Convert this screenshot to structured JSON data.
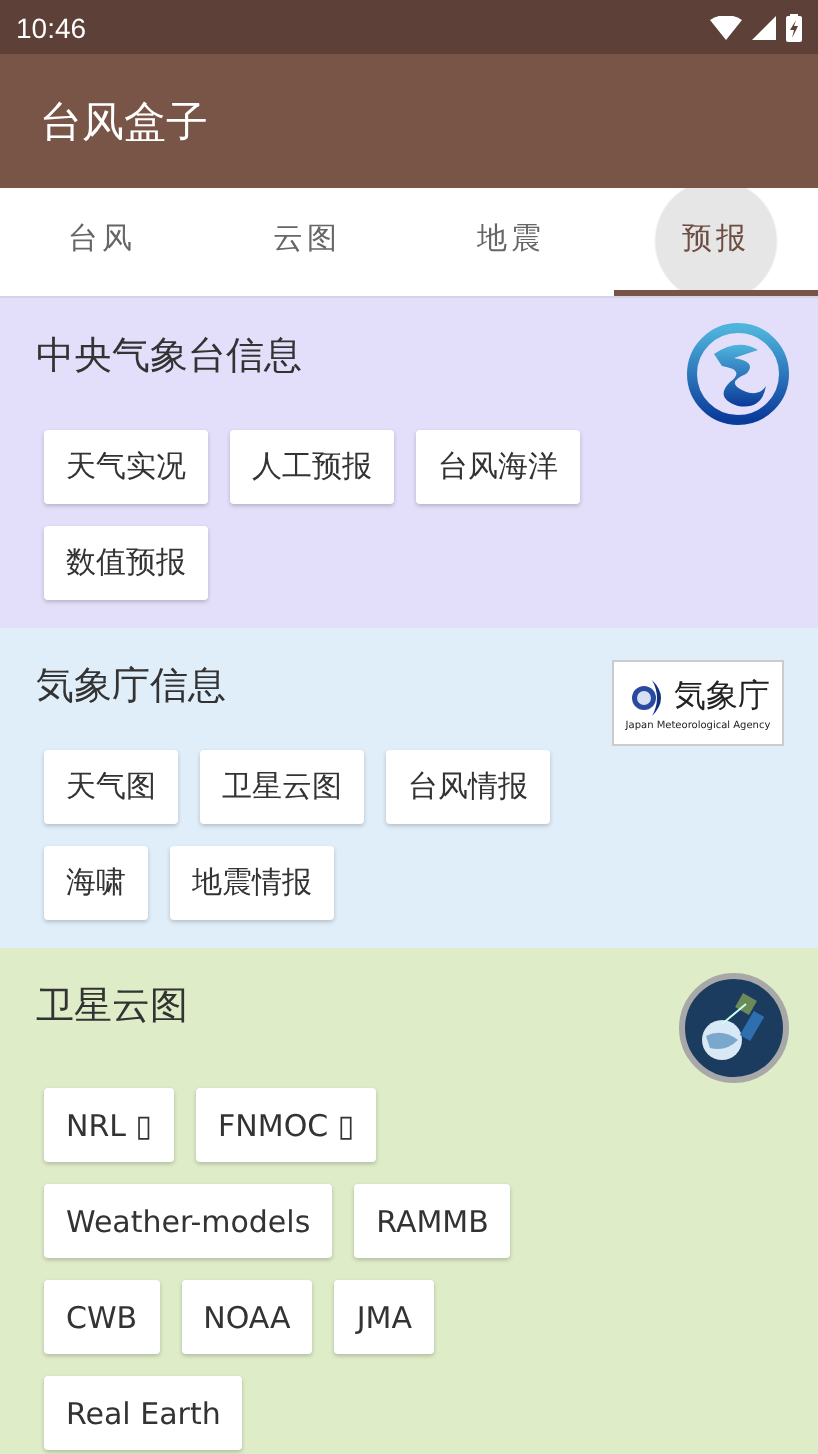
{
  "status_bar": {
    "time": "10:46"
  },
  "app_bar": {
    "title": "台风盒子"
  },
  "tabs": [
    {
      "label": "台风",
      "selected": false
    },
    {
      "label": "云图",
      "selected": false
    },
    {
      "label": "地震",
      "selected": false
    },
    {
      "label": "预报",
      "selected": true
    }
  ],
  "sections": [
    {
      "title": "中央气象台信息",
      "logo": {
        "kind": "cma"
      },
      "color": "#e3dffa",
      "links": [
        "天气实况",
        "人工预报",
        "台风海洋",
        "数值预报"
      ]
    },
    {
      "title": "気象庁信息",
      "logo": {
        "kind": "jma",
        "title": "気象庁",
        "subtitle": "Japan Meteorological Agency"
      },
      "color": "#e0eef9",
      "links": [
        "天气图",
        "卫星云图",
        "台风情报",
        "海啸",
        "地震情报"
      ]
    },
    {
      "title": "卫星云图",
      "logo": {
        "kind": "satellite"
      },
      "color": "#deecc8",
      "links": [
        "NRL ▯",
        "FNMOC ▯",
        "Weather-models",
        "RAMMB",
        "CWB",
        "NOAA",
        "JMA",
        "Real Earth"
      ]
    }
  ]
}
